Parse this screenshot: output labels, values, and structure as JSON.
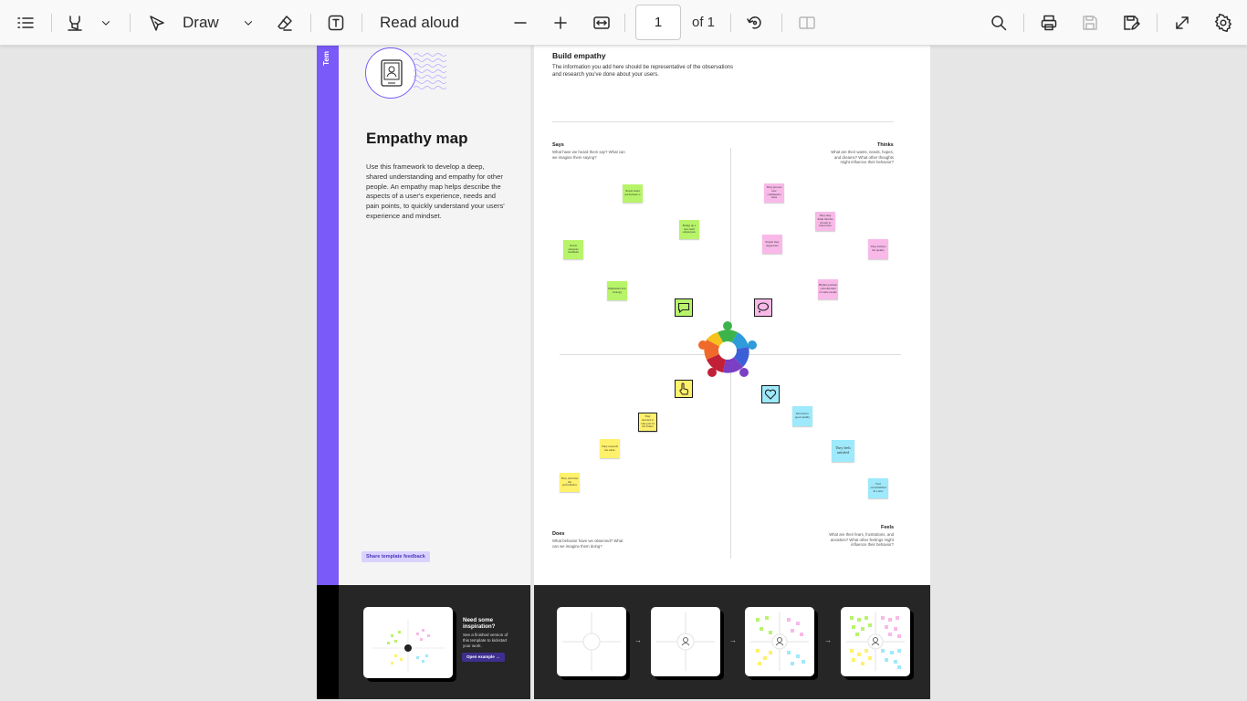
{
  "toolbar": {
    "draw_label": "Draw",
    "read_aloud_label": "Read aloud",
    "page_number": "1",
    "of_label": "of 1"
  },
  "left_panel": {
    "side_tab": "Tem",
    "title": "Empathy map",
    "description": "Use this framework to develop a deep, shared understanding and empathy for other people. An empathy map helps describe the aspects of a user's experience, needs and pain points, to quickly understand your users' experience and mindset.",
    "share_feedback": "Share template feedback",
    "inspiration_title": "Need some inspiration?",
    "inspiration_desc": "See a finished version of this template to kickstart your work.",
    "open_example": "Open example"
  },
  "board": {
    "title": "Build empathy",
    "description": "The information you add here should be representative of the observations and research you've done about your users.",
    "quadrants": {
      "says": {
        "label": "Says",
        "sub": "What have we heard them say? What can we imagine them saying?"
      },
      "thinks": {
        "label": "Thinks",
        "sub": "What are their wants, needs, hopes, and dreams? What other thoughts might influence their behavior?"
      },
      "does": {
        "label": "Does",
        "sub": "What behavior have we observed? What can we imagine them doing?"
      },
      "feels": {
        "label": "Feels",
        "sub": "What are their fears, frustrations, and anxieties? What other feelings might influence their behavior?"
      }
    },
    "notes": {
      "says": [
        {
          "text": "Needs better performanc e",
          "color": "#b8f46a"
        },
        {
          "text": "Brings up a new skill employees",
          "color": "#b8f46a"
        },
        {
          "text": "Needs adequate treatment",
          "color": "#b8f46a"
        },
        {
          "text": "Implement new strategy",
          "color": "#b8f46a"
        }
      ],
      "thinks": [
        {
          "text": "They process new communica tions",
          "color": "#f8b9e8"
        },
        {
          "text": "They may think that the chosen is innovative",
          "color": "#f8b9e8"
        },
        {
          "text": "People may supportive",
          "color": "#f8b9e8"
        },
        {
          "text": "They believe the quality",
          "color": "#f8b9e8"
        },
        {
          "text": "Higher position concentration of some people",
          "color": "#f8b9e8"
        }
      ],
      "does": [
        {
          "text": "They decided to take part in the future",
          "color": "#fff16b"
        },
        {
          "text": "They research the ideas",
          "color": "#fff16b"
        },
        {
          "text": "They advertise the performance",
          "color": "#fff16b"
        }
      ],
      "feels": [
        {
          "text": "Devoted to good quality",
          "color": "#9ee9fb"
        },
        {
          "text": "They feels satisfied",
          "color": "#9ee9fb"
        },
        {
          "text": "Feel overwhelmed in a new",
          "color": "#9ee9fb"
        }
      ]
    }
  }
}
